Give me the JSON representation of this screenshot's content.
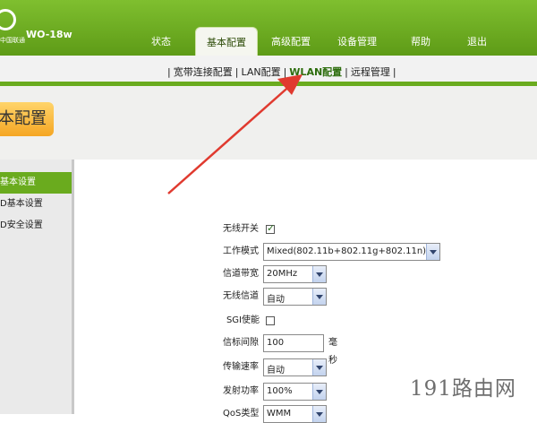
{
  "header": {
    "brand": "中国联通",
    "model": "WO-18w",
    "tabs": [
      "状态",
      "基本配置",
      "高级配置",
      "设备管理",
      "帮助",
      "退出"
    ],
    "active_tab": "基本配置"
  },
  "subnav": {
    "items": [
      "宽带连接配置",
      "LAN配置",
      "WLAN配置",
      "远程管理"
    ],
    "active": "WLAN配置"
  },
  "page_title": "本配置",
  "sidebar": {
    "items": [
      "基本设置",
      "D基本设置",
      "D安全设置"
    ],
    "active": "基本设置"
  },
  "form": {
    "wireless_switch": {
      "label": "无线开关",
      "checked": true,
      "tick": "✓"
    },
    "work_mode": {
      "label": "工作模式",
      "value": "Mixed(802.11b+802.11g+802.11n)"
    },
    "channel_width": {
      "label": "信道带宽",
      "value": "20MHz"
    },
    "wireless_channel": {
      "label": "无线信道",
      "value": "自动"
    },
    "sgi": {
      "label": "SGI使能",
      "checked": false
    },
    "beacon_interval": {
      "label": "信标间隙",
      "value": "100",
      "unit": "毫秒"
    },
    "tx_rate": {
      "label": "传输速率",
      "value": "自动"
    },
    "tx_power": {
      "label": "发射功率",
      "value": "100%"
    },
    "qos_type": {
      "label": "QoS类型",
      "value": "WMM"
    }
  },
  "watermark": "191路由网",
  "colors": {
    "header_green": "#6aab1e",
    "tab_title_orange": "#f5a623",
    "annotation_arrow": "#e03a2f"
  }
}
